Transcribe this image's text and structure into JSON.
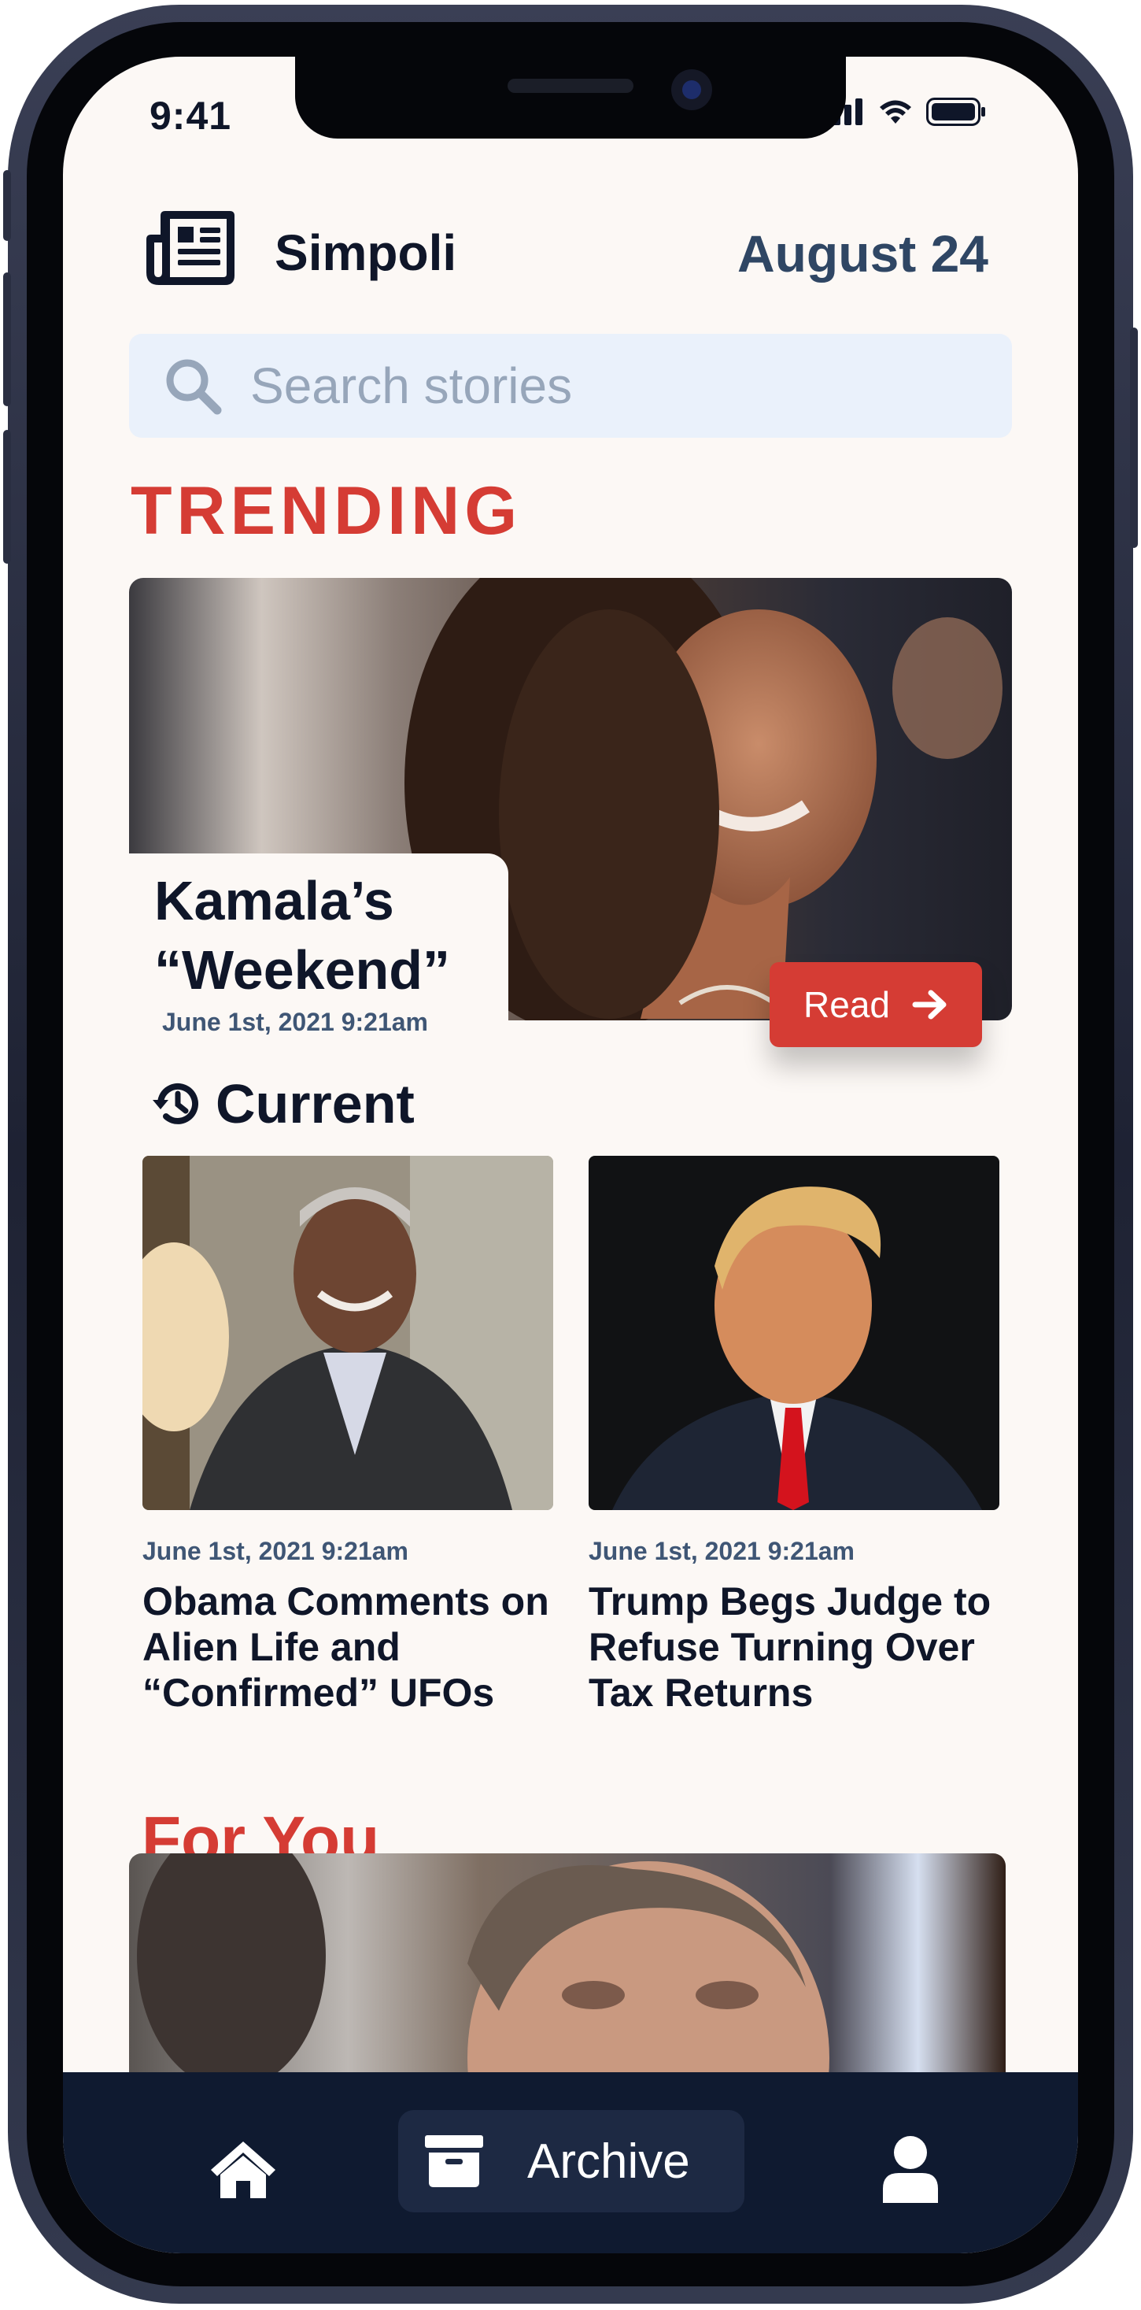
{
  "status_bar": {
    "time": "9:41"
  },
  "header": {
    "app_name": "Simpoli",
    "date": "August 24"
  },
  "search": {
    "placeholder": "Search stories"
  },
  "trending": {
    "section_title": "TRENDING",
    "headline": "Kamala’s “Weekend”",
    "timestamp": "June 1st, 2021  9:21am",
    "read_label": "Read"
  },
  "current": {
    "section_title": "Current",
    "stories": [
      {
        "timestamp": "June 1st, 2021  9:21am",
        "title": "Obama Comments on Alien Life and “Confirmed” UFOs"
      },
      {
        "timestamp": "June 1st, 2021  9:21am",
        "title": "Trump Begs Judge to Refuse Turning Over Tax Returns"
      }
    ]
  },
  "for_you": {
    "section_title": "For You"
  },
  "bottom_nav": {
    "archive_label": "Archive"
  },
  "colors": {
    "accent_red": "#d53c34",
    "navy": "#0f1629",
    "nav_bg": "#0f1a30",
    "screen_bg": "#fcf8f5",
    "search_bg": "#eaf1fb"
  },
  "icons": [
    "newspaper-icon",
    "search-icon",
    "arrow-right-icon",
    "history-icon",
    "home-icon",
    "archive-box-icon",
    "user-icon",
    "signal-icon",
    "wifi-icon",
    "battery-icon"
  ]
}
